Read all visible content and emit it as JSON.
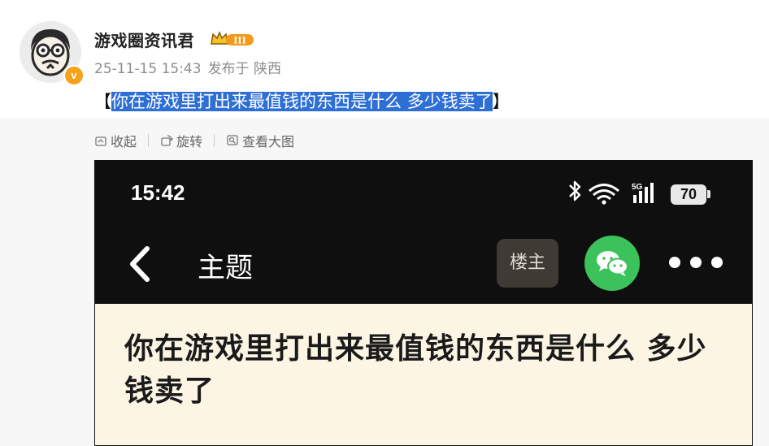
{
  "author": {
    "name": "游戏圈资讯君",
    "vip_level": "III",
    "verified_mark": "v"
  },
  "post": {
    "date": "25-11-15 15:43",
    "location": "发布于 陕西",
    "bracket_open": "【",
    "title_selected": "你在游戏里打出来最值钱的东西是什么 多少钱卖了",
    "bracket_close": "】"
  },
  "toolbar": {
    "collapse": "收起",
    "rotate": "旋转",
    "view_large": "查看大图"
  },
  "screenshot": {
    "time": "15:42",
    "network": "5G",
    "battery": "70",
    "nav_title": "主题",
    "owner_label": "楼主",
    "thread_title": "你在游戏里打出来最值钱的东西是什么 多少钱卖了",
    "colors": {
      "bar_bg": "#0f0f0f",
      "content_bg": "#fdf5e4",
      "wechat": "#3cc25b",
      "selection": "#2e6fd6"
    }
  }
}
